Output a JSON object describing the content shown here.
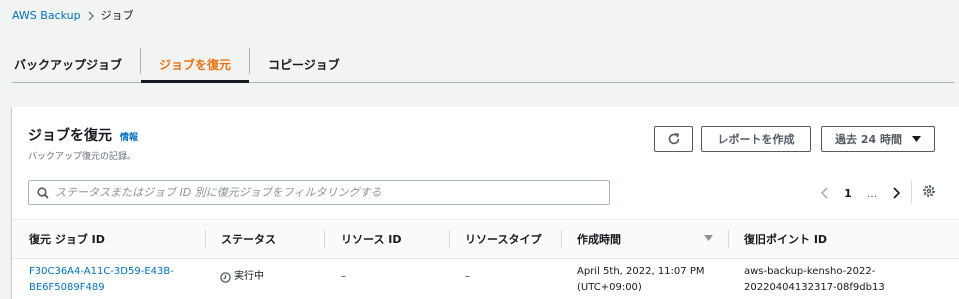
{
  "breadcrumb": {
    "root": "AWS Backup",
    "current": "ジョブ"
  },
  "tabs": [
    {
      "label": "バックアップジョブ"
    },
    {
      "label": "ジョブを復元"
    },
    {
      "label": "コピージョブ"
    }
  ],
  "active_tab_color": "#ec7211",
  "panel": {
    "title": "ジョブを復元",
    "info": "情報",
    "description": "バックアップ復元の記録。",
    "report_button": "レポートを作成",
    "time_range": "過去 24 時間"
  },
  "search": {
    "placeholder": "ステータスまたはジョブ ID 別に復元ジョブをフィルタリングする",
    "value": ""
  },
  "pagination": {
    "page": "1",
    "ellipsis": "..."
  },
  "table": {
    "columns": [
      "復元 ジョブ ID",
      "ステータス",
      "リソース ID",
      "リソースタイプ",
      "作成時間",
      "復旧ポイント ID"
    ],
    "rows": [
      {
        "job_id_line1": "F30C36A4-A11C-3D59-E43B-",
        "job_id_line2": "BE6F5089F489",
        "status": "実行中",
        "resource_id": "–",
        "resource_type": "–",
        "created_line1": "April 5th, 2022, 11:07 PM",
        "created_line2": "(UTC+09:00)",
        "recovery_point_line1": "aws-backup-kensho-2022-",
        "recovery_point_line2": "20220404132317-08f9db13"
      }
    ]
  }
}
